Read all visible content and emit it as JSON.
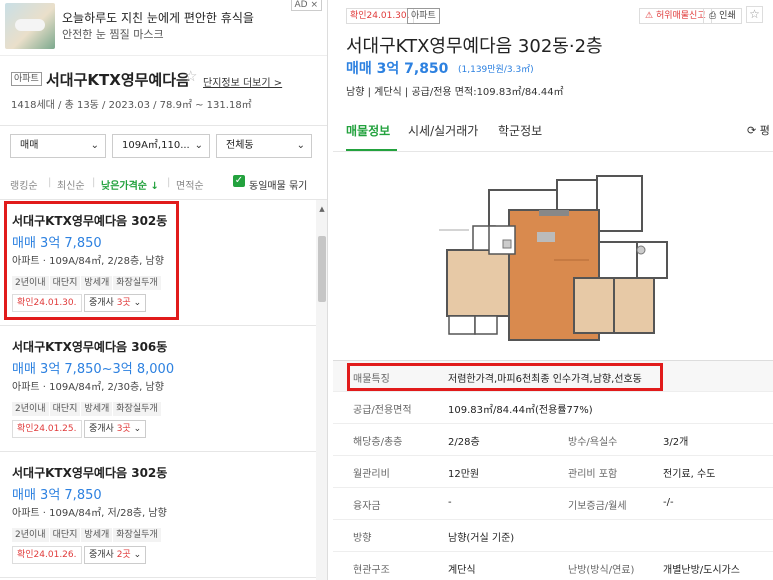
{
  "ad": {
    "badge": "AD ×",
    "title": "오늘하루도 지친 눈에게 편안한 휴식을",
    "subtitle": "안전한 눈 찜질 마스크"
  },
  "complex": {
    "type_badge": "아파트",
    "name": "서대구KTX영무예다음",
    "star": "☆",
    "detail_link": "단지정보 더보기 >",
    "info": "1418세대 / 총 13동 / 2023.03 / 78.9㎡ ~ 131.18㎡"
  },
  "filters": [
    {
      "value": "매매",
      "chevron": "⌄"
    },
    {
      "value": "109A㎡,110...",
      "chevron": "⌄"
    },
    {
      "value": "전체동",
      "chevron": "⌄"
    }
  ],
  "sort": {
    "options": [
      "랭킹순",
      "최신순",
      "낮은가격순 ↓",
      "면적순"
    ],
    "same_listing_label": "동일매물 묶기",
    "same_listing_checked": true
  },
  "listings": [
    {
      "title": "서대구KTX영무예다음 302동",
      "price": "매매 3억 7,850",
      "spec": "아파트 · 109A/84㎡, 2/28층, 남향",
      "tags": [
        "2년이내",
        "대단지",
        "방세개",
        "화장실두개"
      ],
      "confirm": "확인24.01.30.",
      "agent_prefix": "중개사 ",
      "agent_count": "3곳",
      "agent_suffix": " ⌄"
    },
    {
      "title": "서대구KTX영무예다음 306동",
      "price": "매매 3억 7,850~3억 8,000",
      "spec": "아파트 · 109A/84㎡, 2/30층, 남향",
      "tags": [
        "2년이내",
        "대단지",
        "방세개",
        "화장실두개"
      ],
      "confirm": "확인24.01.25.",
      "agent_prefix": "중개사 ",
      "agent_count": "3곳",
      "agent_suffix": " ⌄"
    },
    {
      "title": "서대구KTX영무예다음 302동",
      "price": "매매 3억 7,850",
      "spec": "아파트 · 109A/84㎡, 저/28층, 남향",
      "tags": [
        "2년이내",
        "대단지",
        "방세개",
        "화장실두개"
      ],
      "confirm": "확인24.01.26.",
      "agent_prefix": "중개사 ",
      "agent_count": "2곳",
      "agent_suffix": " ⌄"
    }
  ],
  "detail": {
    "confirm_badge": "확인24.01.30.",
    "type_badge": "아파트",
    "report_btn": "허위매물신고",
    "print_btn": "인쇄",
    "fav": "☆",
    "title": "서대구KTX영무예다음 302동·2층",
    "price": "매매 3억 7,850",
    "price_per": "(1,139만원/3.3㎡)",
    "meta": "남향 | 계단식 | 공급/전용 면적:109.83㎡/84.44㎡",
    "tabs": [
      "매물정보",
      "시세/실거래가",
      "학군정보"
    ],
    "refresh": "⟳ 평",
    "rows": [
      {
        "label": "매물특징",
        "value": "저렴한가격,마피6천최종 인수가격,남향,선호동"
      },
      {
        "label": "공급/전용면적",
        "value": "109.83㎡/84.44㎡(전용률77%)"
      },
      {
        "label": "해당층/총층",
        "value": "2/28층",
        "label2": "방수/욕실수",
        "value2": "3/2개"
      },
      {
        "label": "월관리비",
        "value": "12만원",
        "label2": "관리비 포함",
        "value2": "전기료, 수도"
      },
      {
        "label": "융자금",
        "value": "-",
        "label2": "기보증금/월세",
        "value2": "-/-"
      },
      {
        "label": "방향",
        "value": "남향(거실 기준)"
      },
      {
        "label": "현관구조",
        "value": "계단식",
        "label2": "난방(방식/연료)",
        "value2": "개별난방/도시가스"
      }
    ]
  },
  "colors": {
    "accent_green": "#23a23e",
    "price_blue": "#2d81e0",
    "alert_red": "#e03a3a",
    "highlight_red": "#e11b1b"
  }
}
